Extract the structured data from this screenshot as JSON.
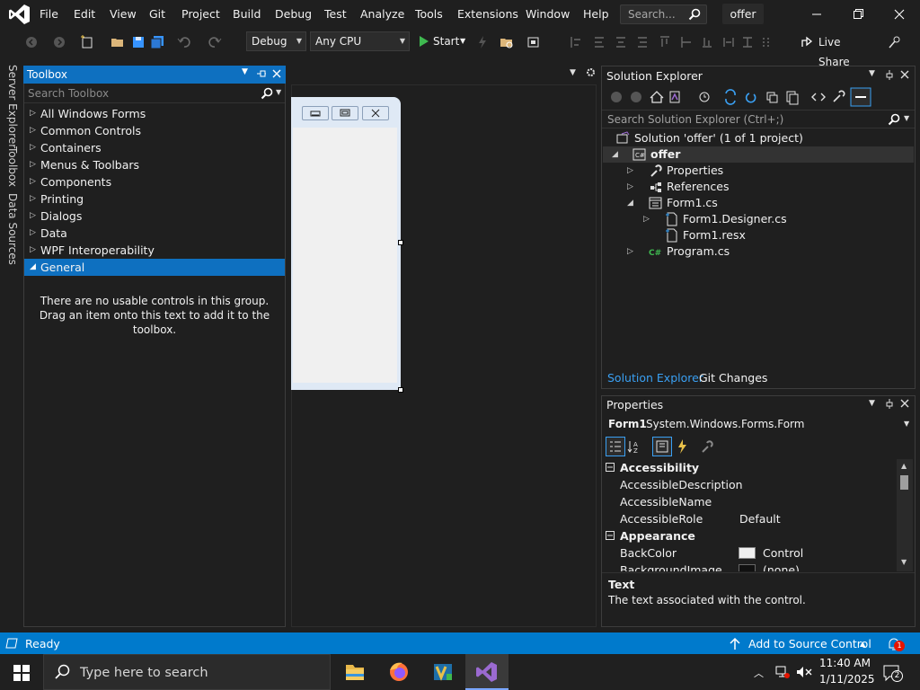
{
  "menu": {
    "items": [
      "File",
      "Edit",
      "View",
      "Git",
      "Project",
      "Build",
      "Debug",
      "Test",
      "Analyze",
      "Tools",
      "Extensions",
      "Window",
      "Help"
    ],
    "search_placeholder": "Search...",
    "solution_name": "offer"
  },
  "toolbar": {
    "config": "Debug",
    "platform": "Any CPU",
    "start_label": "Start",
    "live_share_label": "Live Share"
  },
  "left_strip": {
    "tabs": [
      "Server Explorer",
      "Toolbox",
      "Data Sources"
    ]
  },
  "toolbox": {
    "title": "Toolbox",
    "search_placeholder": "Search Toolbox",
    "groups": [
      "All Windows Forms",
      "Common Controls",
      "Containers",
      "Menus & Toolbars",
      "Components",
      "Printing",
      "Dialogs",
      "Data",
      "WPF Interoperability",
      "General"
    ],
    "selected_group": "General",
    "empty_message": "There are no usable controls in this group. Drag an item onto this text to add it to the toolbox."
  },
  "solution_explorer": {
    "title": "Solution Explorer",
    "search_placeholder": "Search Solution Explorer (Ctrl+;)",
    "solution_label": "Solution 'offer' (1 of 1 project)",
    "project": "offer",
    "items": [
      "Properties",
      "References",
      "Form1.cs",
      "Form1.Designer.cs",
      "Form1.resx",
      "Program.cs"
    ],
    "tabs": [
      "Solution Explorer",
      "Git Changes"
    ]
  },
  "properties": {
    "title": "Properties",
    "object_name": "Form1",
    "object_type": "System.Windows.Forms.Form",
    "categories": [
      {
        "name": "Accessibility",
        "rows": [
          {
            "name": "AccessibleDescription",
            "value": ""
          },
          {
            "name": "AccessibleName",
            "value": ""
          },
          {
            "name": "AccessibleRole",
            "value": "Default"
          }
        ]
      },
      {
        "name": "Appearance",
        "rows": [
          {
            "name": "BackColor",
            "value": "Control"
          },
          {
            "name": "BackgroundImage",
            "value": "(none)"
          }
        ]
      }
    ],
    "desc_title": "Text",
    "desc_text": "The text associated with the control."
  },
  "status": {
    "ready": "Ready",
    "add_source_control": "Add to Source Control",
    "notification_count": "1"
  },
  "taskbar": {
    "search_placeholder": "Type here to search",
    "time": "11:40 AM",
    "date": "1/11/2025",
    "notification_count": "2"
  },
  "colors": {
    "accent": "#0e70c0",
    "statusbar": "#007acc",
    "vs_purple": "#9b6ad1"
  },
  "icons": [
    "visual-studio-logo",
    "search-icon",
    "minimize-icon",
    "restore-icon",
    "close-icon",
    "play-icon",
    "live-share-icon",
    "pin-icon",
    "chevron-down-icon",
    "solution-icon",
    "csharp-project-icon",
    "wrench-icon",
    "references-icon",
    "form-icon",
    "file-icon",
    "csharp-file-icon",
    "wifi-icon",
    "volume-muted-icon",
    "notification-icon"
  ]
}
